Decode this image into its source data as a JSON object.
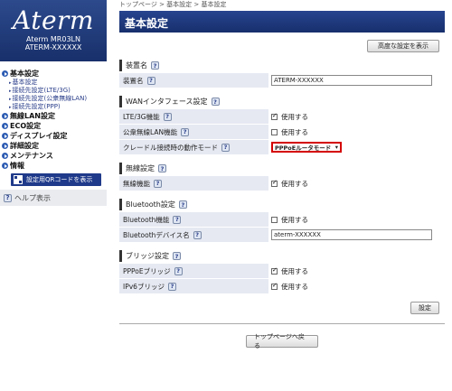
{
  "logo_text": "Aterm",
  "device": {
    "model": "Aterm MR03LN",
    "name": "ATERM-XXXXXX"
  },
  "nav": {
    "basic": "基本設定",
    "basic_subs": [
      "基本設定",
      "接続先設定(LTE/3G)",
      "接続先設定(公衆無線LAN)",
      "接続先設定(PPP)"
    ],
    "wlan": "無線LAN設定",
    "eco": "ECO設定",
    "display": "ディスプレイ設定",
    "detail": "詳細設定",
    "maint": "メンテナンス",
    "info": "情報",
    "qr_button": "設定用QRコードを表示",
    "help": "ヘルプ表示"
  },
  "breadcrumb": "トップページ > 基本設定 > 基本設定",
  "page_title": "基本設定",
  "advanced_button": "高度な設定を表示",
  "help_glyph": "?",
  "sections": {
    "device_name": {
      "title": "装置名",
      "label": "装置名",
      "value": "ATERM-XXXXXX"
    },
    "wan": {
      "title": "WANインタフェース設定",
      "lte_label": "LTE/3G機能",
      "lte_check": "使用する",
      "public_label": "公衆無線LAN機能",
      "public_check": "使用する",
      "cradle_label": "クレードル接続時の動作モード",
      "cradle_value": "PPPoEルータモード"
    },
    "wireless": {
      "title": "無線設定",
      "label": "無線機能",
      "check": "使用する"
    },
    "bluetooth": {
      "title": "Bluetooth設定",
      "func_label": "Bluetooth機能",
      "func_check": "使用する",
      "name_label": "Bluetoothデバイス名",
      "name_value": "aterm-XXXXXX"
    },
    "bridge": {
      "title": "ブリッジ設定",
      "pppoe_label": "PPPoEブリッジ",
      "pppoe_check": "使用する",
      "ipv6_label": "IPv6ブリッジ",
      "ipv6_check": "使用する"
    }
  },
  "set_button": "設定",
  "top_button": "トップページへ戻る",
  "colors": {
    "title_bar": "#1f3a7c",
    "row_bg": "#e6e9f2",
    "highlight": "#d40000"
  }
}
